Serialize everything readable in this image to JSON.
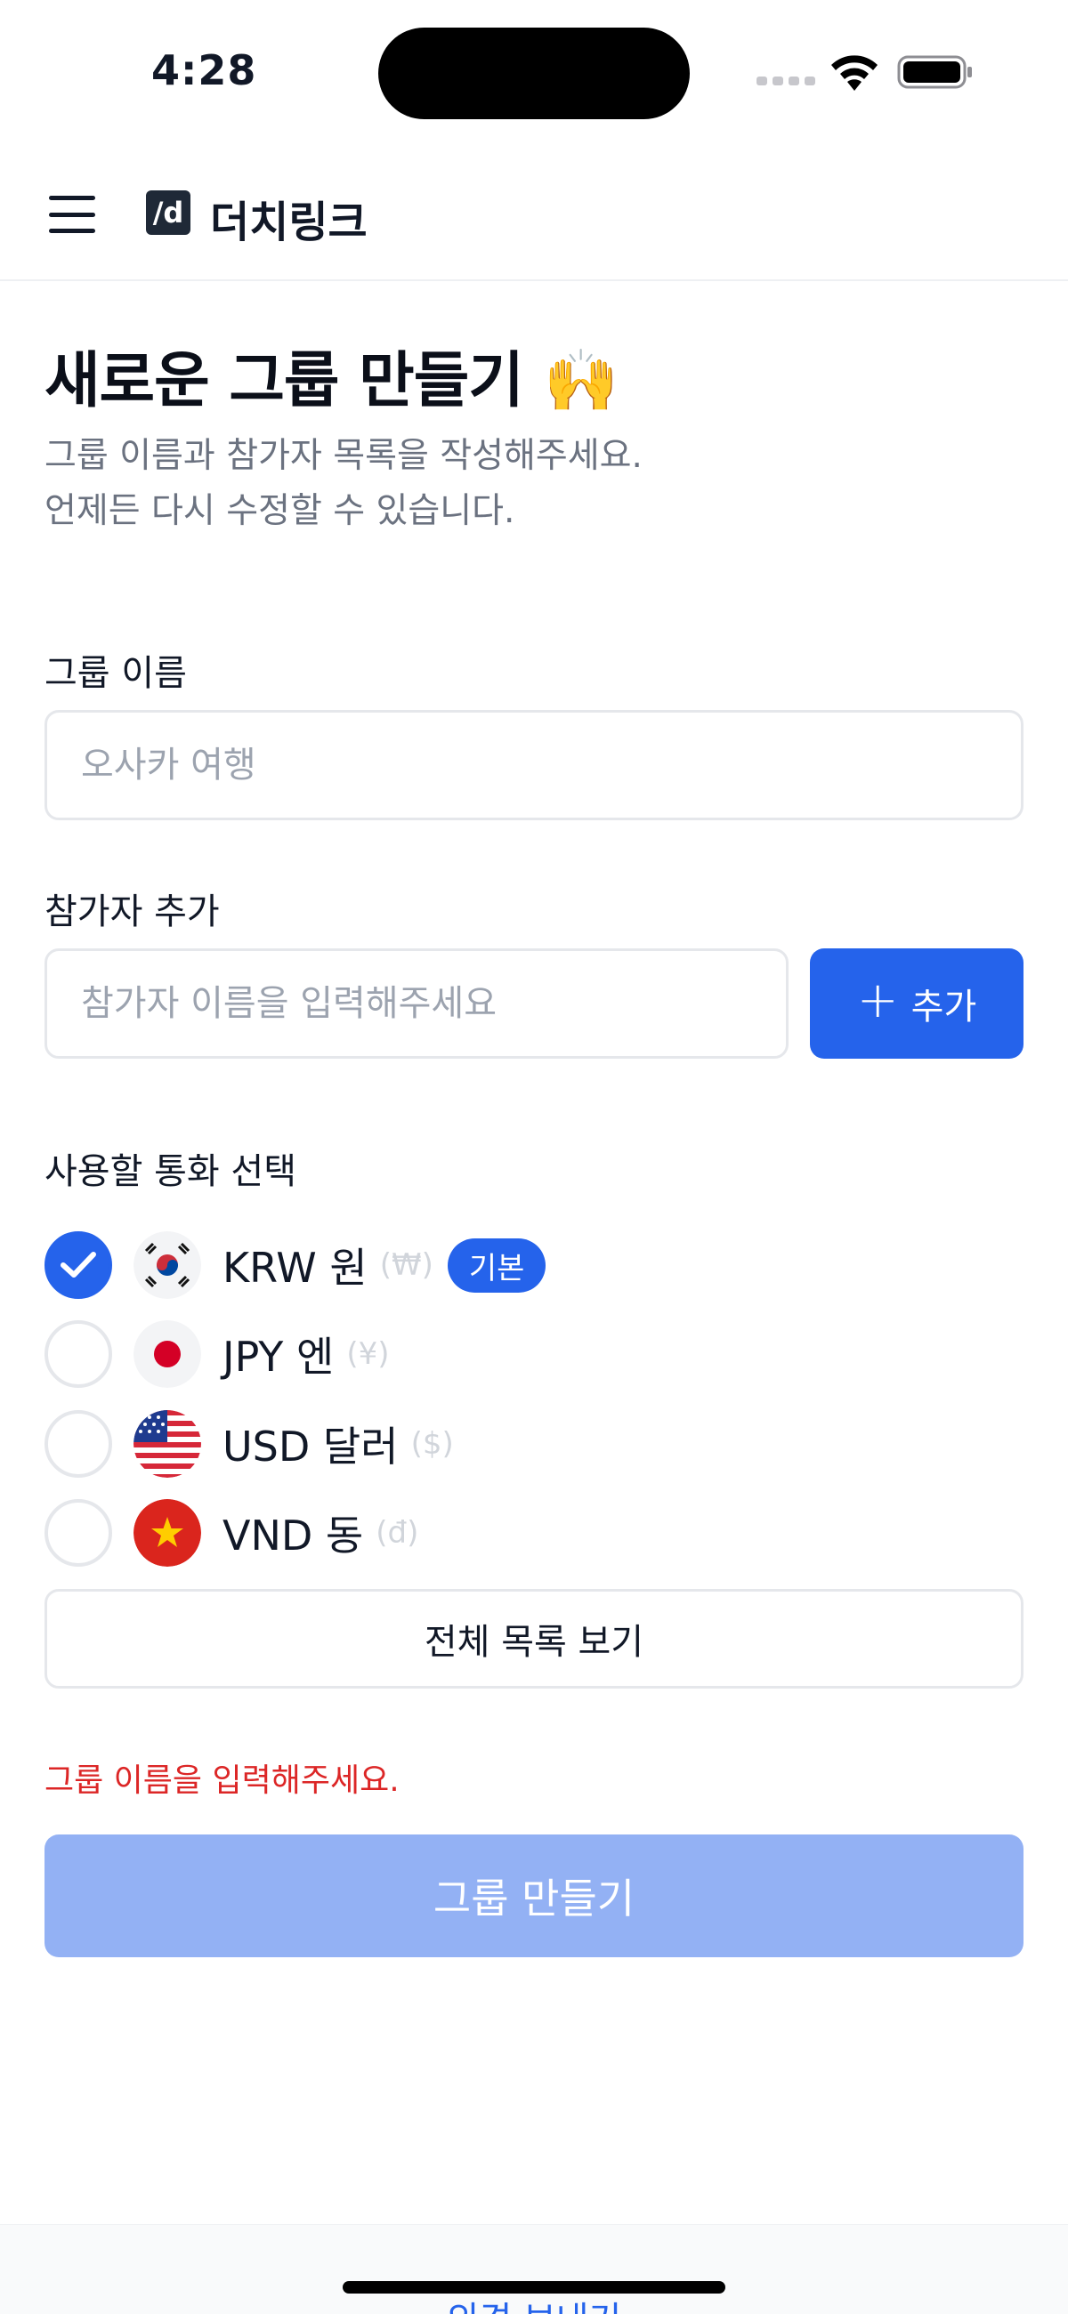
{
  "status_bar": {
    "time": "4:28"
  },
  "header": {
    "logo_text": "/d",
    "brand": "더치링크"
  },
  "page": {
    "title": "새로운 그룹 만들기 🙌",
    "subtitle_line1": "그룹 이름과 참가자 목록을 작성해주세요.",
    "subtitle_line2": "언제든 다시 수정할 수 있습니다."
  },
  "group_name": {
    "label": "그룹 이름",
    "placeholder": "오사카 여행",
    "value": ""
  },
  "participants": {
    "label": "참가자 추가",
    "placeholder": "참가자 이름을 입력해주세요",
    "add_label": "추가",
    "add_icon": "plus-icon"
  },
  "currency": {
    "label": "사용할 통화 선택",
    "items": [
      {
        "name": "KRW 원",
        "symbol": "(₩)",
        "badge": "기본",
        "checked": true,
        "flag": "flag-kr-icon"
      },
      {
        "name": "JPY 엔",
        "symbol": "(¥)",
        "checked": false,
        "flag": "flag-jp-icon"
      },
      {
        "name": "USD 달러",
        "symbol": "($)",
        "checked": false,
        "flag": "flag-us-icon"
      },
      {
        "name": "VND 동",
        "symbol": "(đ)",
        "checked": false,
        "flag": "flag-vn-icon"
      }
    ],
    "view_all": "전체 목록 보기"
  },
  "error_message": "그룹 이름을 입력해주세요.",
  "submit_label": "그룹 만들기",
  "footer_link": "의견 보내기",
  "colors": {
    "primary": "#2563eb",
    "primary_disabled": "#93b1f4",
    "error": "#dc2626",
    "muted_text": "#6b7280"
  }
}
